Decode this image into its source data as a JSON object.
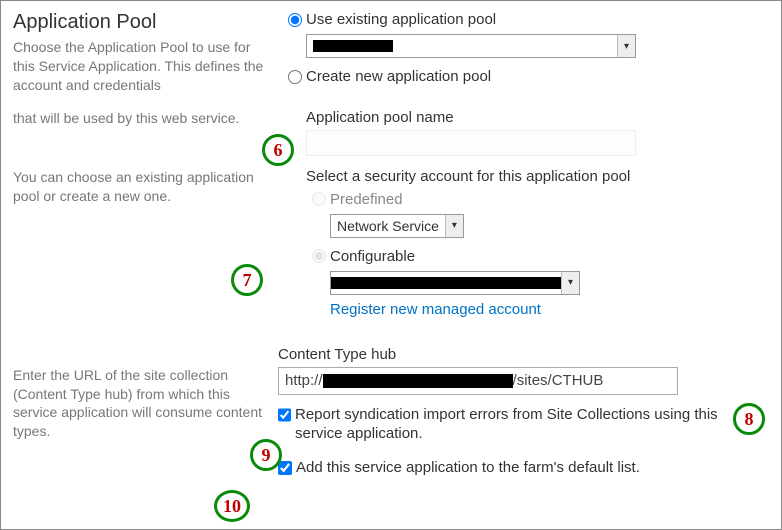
{
  "appPool": {
    "title": "Application Pool",
    "help1": "Choose the Application Pool to use for this Service Application.  This defines the account and credentials",
    "help2": "that will be used by this web service.",
    "help3": "You can choose an existing application pool or create a new one.",
    "radioExisting": "Use existing application pool",
    "radioCreate": "Create new application pool",
    "poolNameLabel": "Application pool name",
    "securityLabel": "Select a security account for this application pool",
    "radioPredefined": "Predefined",
    "predefinedValue": "Network Service",
    "radioConfigurable": "Configurable",
    "registerLink": "Register new managed account"
  },
  "contentHub": {
    "label": "Content Type hub",
    "urlPrefix": "http://",
    "urlSuffix": "/sites/CTHUB",
    "help": "Enter the URL of the site collection (Content Type hub) from which this service application will consume content types.",
    "cbReport": "Report syndication import errors from Site Collections using this service application.",
    "cbDefault": "Add this service application to the farm's default list."
  },
  "annotations": {
    "a6": "6",
    "a7": "7",
    "a8": "8",
    "a9": "9",
    "a10": "10"
  }
}
